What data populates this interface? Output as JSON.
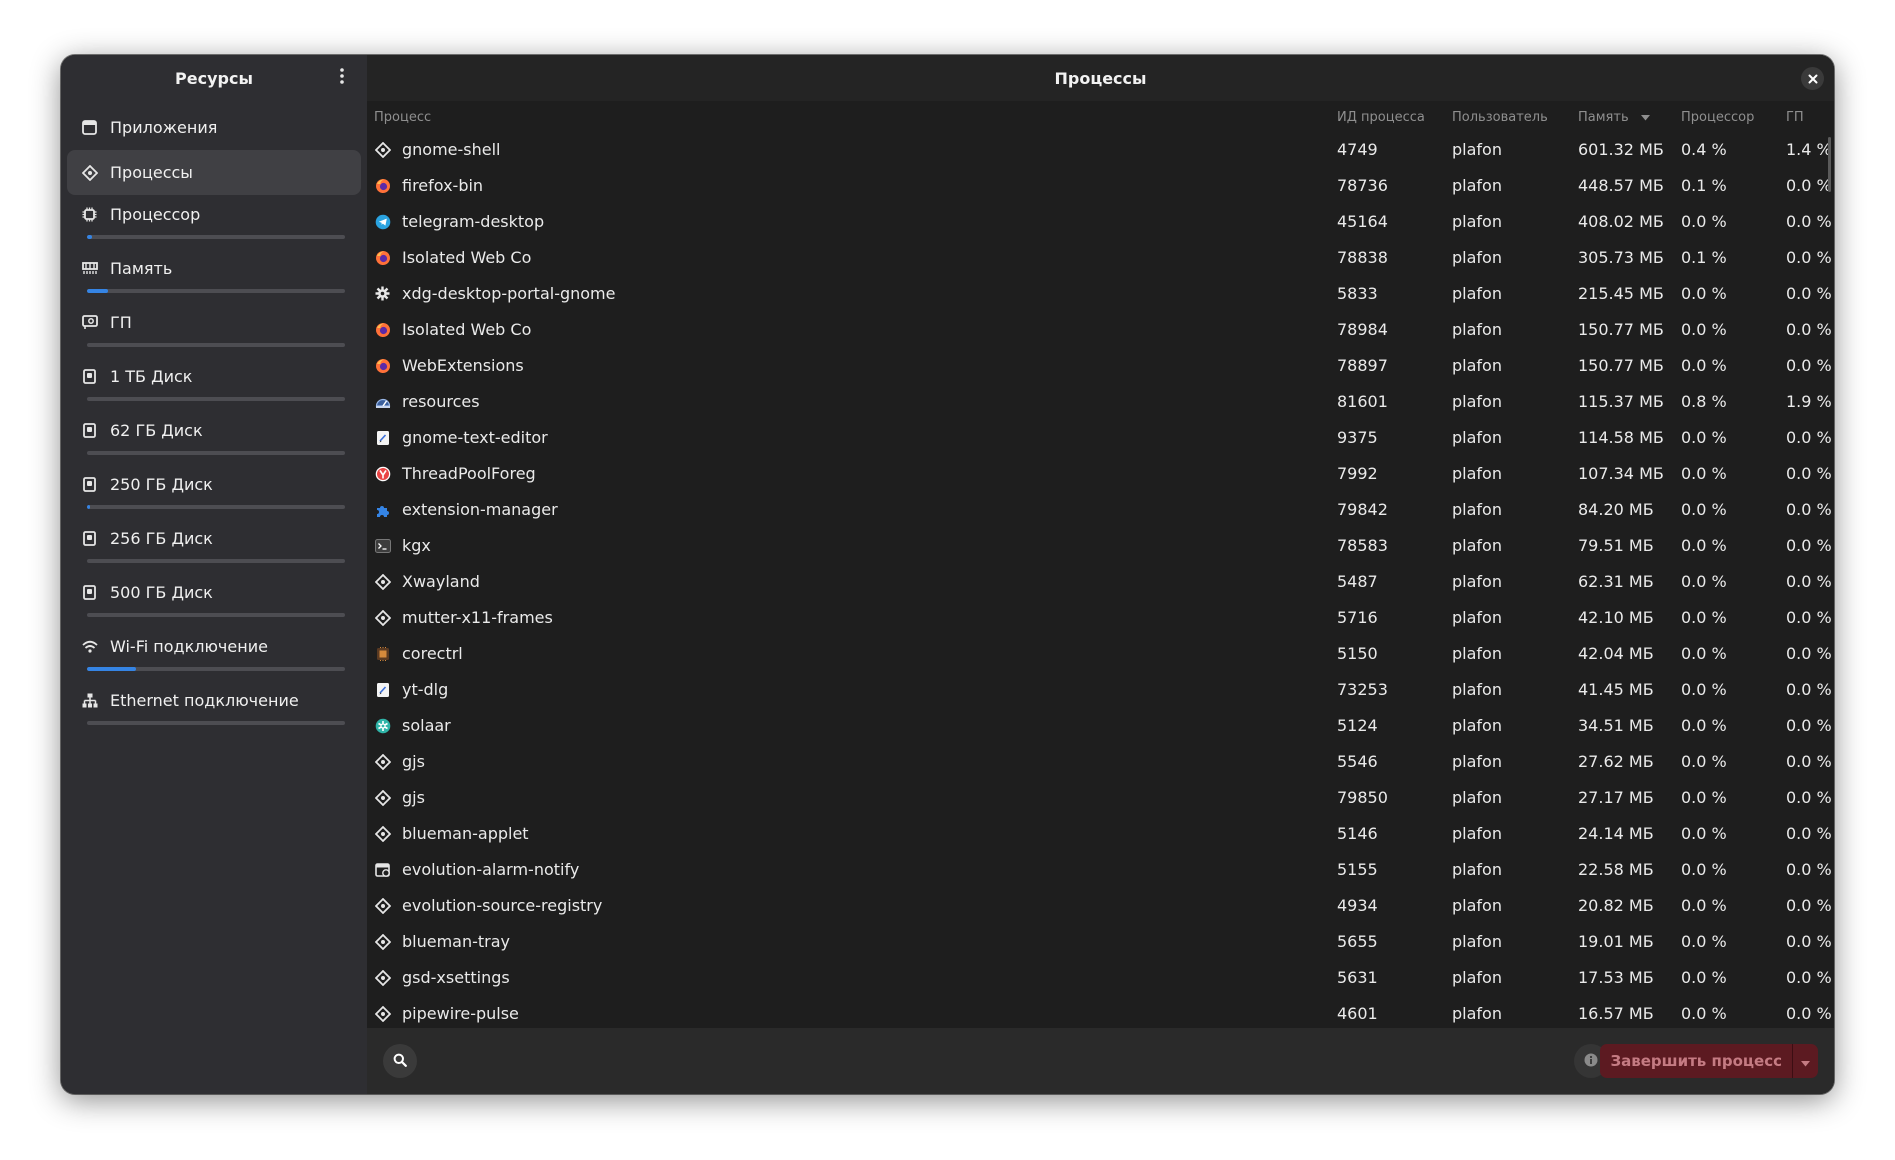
{
  "sidebar": {
    "title": "Ресурсы",
    "menu_icon": "vertical-dots-icon",
    "items": [
      {
        "label": "Приложения",
        "icon": "window-icon",
        "meter": null,
        "active": false
      },
      {
        "label": "Процессы",
        "icon": "process-icon",
        "meter": null,
        "active": true
      },
      {
        "label": "Процессор",
        "icon": "cpu-icon",
        "meter": 0.02
      },
      {
        "label": "Память",
        "icon": "memory-icon",
        "meter": 0.08
      },
      {
        "label": "ГП",
        "icon": "gpu-icon",
        "meter": 0.0
      },
      {
        "label": "1 ТБ Диск",
        "icon": "disk-icon",
        "meter": 0.0
      },
      {
        "label": "62 ГБ Диск",
        "icon": "disk-icon",
        "meter": 0.0
      },
      {
        "label": "250 ГБ Диск",
        "icon": "disk-icon",
        "meter": 0.01
      },
      {
        "label": "256 ГБ Диск",
        "icon": "disk-icon",
        "meter": 0.0
      },
      {
        "label": "500 ГБ Диск",
        "icon": "disk-icon",
        "meter": 0.0
      },
      {
        "label": "Wi-Fi подключение",
        "icon": "wifi-icon",
        "meter": 0.19
      },
      {
        "label": "Ethernet подключение",
        "icon": "ethernet-icon",
        "meter": 0.0
      }
    ]
  },
  "main": {
    "title": "Процессы",
    "close_icon": "close-icon",
    "columns": {
      "process": "Процесс",
      "pid": "ИД процесса",
      "user": "Пользователь",
      "memory": "Память",
      "cpu": "Процессор",
      "gpu": "ГП"
    },
    "sort_indicator": "sort-down-icon",
    "rows": [
      {
        "name": "gnome-shell",
        "pid": "4749",
        "user": "plafon",
        "memory": "601.32 МБ",
        "cpu": "0.4 %",
        "gpu": "1.4 %",
        "icon": "generic-process-icon"
      },
      {
        "name": "firefox-bin",
        "pid": "78736",
        "user": "plafon",
        "memory": "448.57 МБ",
        "cpu": "0.1 %",
        "gpu": "0.0 %",
        "icon": "firefox-icon"
      },
      {
        "name": "telegram-desktop",
        "pid": "45164",
        "user": "plafon",
        "memory": "408.02 МБ",
        "cpu": "0.0 %",
        "gpu": "0.0 %",
        "icon": "telegram-icon"
      },
      {
        "name": "Isolated Web Co",
        "pid": "78838",
        "user": "plafon",
        "memory": "305.73 МБ",
        "cpu": "0.1 %",
        "gpu": "0.0 %",
        "icon": "firefox-icon"
      },
      {
        "name": "xdg-desktop-portal-gnome",
        "pid": "5833",
        "user": "plafon",
        "memory": "215.45 МБ",
        "cpu": "0.0 %",
        "gpu": "0.0 %",
        "icon": "gear-icon"
      },
      {
        "name": "Isolated Web Co",
        "pid": "78984",
        "user": "plafon",
        "memory": "150.77 МБ",
        "cpu": "0.0 %",
        "gpu": "0.0 %",
        "icon": "firefox-icon"
      },
      {
        "name": "WebExtensions",
        "pid": "78897",
        "user": "plafon",
        "memory": "150.77 МБ",
        "cpu": "0.0 %",
        "gpu": "0.0 %",
        "icon": "firefox-icon"
      },
      {
        "name": "resources",
        "pid": "81601",
        "user": "plafon",
        "memory": "115.37 МБ",
        "cpu": "0.8 %",
        "gpu": "1.9 %",
        "icon": "resources-icon"
      },
      {
        "name": "gnome-text-editor",
        "pid": "9375",
        "user": "plafon",
        "memory": "114.58 МБ",
        "cpu": "0.0 %",
        "gpu": "0.0 %",
        "icon": "text-editor-icon"
      },
      {
        "name": "ThreadPoolForeg",
        "pid": "7992",
        "user": "plafon",
        "memory": "107.34 МБ",
        "cpu": "0.0 %",
        "gpu": "0.0 %",
        "icon": "yandex-browser-icon"
      },
      {
        "name": "extension-manager",
        "pid": "79842",
        "user": "plafon",
        "memory": "84.20 МБ",
        "cpu": "0.0 %",
        "gpu": "0.0 %",
        "icon": "puzzle-icon"
      },
      {
        "name": "kgx",
        "pid": "78583",
        "user": "plafon",
        "memory": "79.51 МБ",
        "cpu": "0.0 %",
        "gpu": "0.0 %",
        "icon": "terminal-icon"
      },
      {
        "name": "Xwayland",
        "pid": "5487",
        "user": "plafon",
        "memory": "62.31 МБ",
        "cpu": "0.0 %",
        "gpu": "0.0 %",
        "icon": "generic-process-icon"
      },
      {
        "name": "mutter-x11-frames",
        "pid": "5716",
        "user": "plafon",
        "memory": "42.10 МБ",
        "cpu": "0.0 %",
        "gpu": "0.0 %",
        "icon": "generic-process-icon"
      },
      {
        "name": "corectrl",
        "pid": "5150",
        "user": "plafon",
        "memory": "42.04 МБ",
        "cpu": "0.0 %",
        "gpu": "0.0 %",
        "icon": "corectrl-icon"
      },
      {
        "name": "yt-dlg",
        "pid": "73253",
        "user": "plafon",
        "memory": "41.45 МБ",
        "cpu": "0.0 %",
        "gpu": "0.0 %",
        "icon": "text-editor-icon"
      },
      {
        "name": "solaar",
        "pid": "5124",
        "user": "plafon",
        "memory": "34.51 МБ",
        "cpu": "0.0 %",
        "gpu": "0.0 %",
        "icon": "solaar-icon"
      },
      {
        "name": "gjs",
        "pid": "5546",
        "user": "plafon",
        "memory": "27.62 МБ",
        "cpu": "0.0 %",
        "gpu": "0.0 %",
        "icon": "generic-process-icon"
      },
      {
        "name": "gjs",
        "pid": "79850",
        "user": "plafon",
        "memory": "27.17 МБ",
        "cpu": "0.0 %",
        "gpu": "0.0 %",
        "icon": "generic-process-icon"
      },
      {
        "name": "blueman-applet",
        "pid": "5146",
        "user": "plafon",
        "memory": "24.14 МБ",
        "cpu": "0.0 %",
        "gpu": "0.0 %",
        "icon": "generic-process-icon"
      },
      {
        "name": "evolution-alarm-notify",
        "pid": "5155",
        "user": "plafon",
        "memory": "22.58 МБ",
        "cpu": "0.0 %",
        "gpu": "0.0 %",
        "icon": "calendar-icon"
      },
      {
        "name": "evolution-source-registry",
        "pid": "4934",
        "user": "plafon",
        "memory": "20.82 МБ",
        "cpu": "0.0 %",
        "gpu": "0.0 %",
        "icon": "generic-process-icon"
      },
      {
        "name": "blueman-tray",
        "pid": "5655",
        "user": "plafon",
        "memory": "19.01 МБ",
        "cpu": "0.0 %",
        "gpu": "0.0 %",
        "icon": "generic-process-icon"
      },
      {
        "name": "gsd-xsettings",
        "pid": "5631",
        "user": "plafon",
        "memory": "17.53 МБ",
        "cpu": "0.0 %",
        "gpu": "0.0 %",
        "icon": "generic-process-icon"
      },
      {
        "name": "pipewire-pulse",
        "pid": "4601",
        "user": "plafon",
        "memory": "16.57 МБ",
        "cpu": "0.0 %",
        "gpu": "0.0 %",
        "icon": "generic-process-icon"
      }
    ]
  },
  "bottom_bar": {
    "search_icon": "search-icon",
    "info_icon": "info-icon",
    "end_process_label": "Завершить процесс",
    "dropdown_icon": "chevron-down-icon"
  },
  "colors": {
    "accent": "#3584e4",
    "destructive_bg": "#5c1a21",
    "destructive_text": "#c57b83"
  }
}
